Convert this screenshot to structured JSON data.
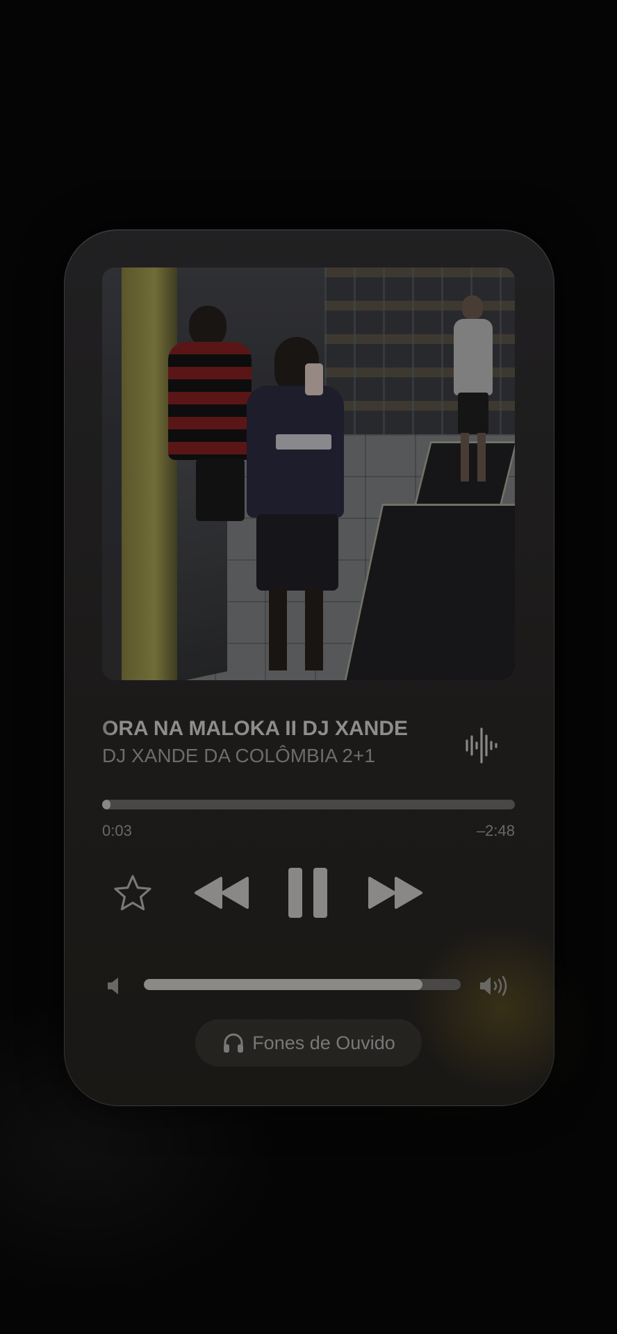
{
  "now_playing": {
    "title": "ORA NA MALOKA II DJ XANDE",
    "artist": "DJ XANDE DA COLÔMBIA 2+1",
    "artwork_icon": "album-artwork-photo",
    "audio_quality_icon": "waveform-icon"
  },
  "progress": {
    "elapsed": "0:03",
    "remaining": "–2:48",
    "fraction": 0.02
  },
  "controls": {
    "favorite_icon": "star-icon",
    "previous_icon": "backward-icon",
    "play_pause_icon": "pause-icon",
    "next_icon": "forward-icon"
  },
  "volume": {
    "level": 0.88,
    "low_icon": "speaker-low-icon",
    "high_icon": "speaker-high-icon"
  },
  "output": {
    "label": "Fones de Ouvido",
    "icon": "headphones-icon"
  },
  "colors": {
    "card_bg": "#222123",
    "text_primary": "#8e8d8b",
    "text_secondary": "#6e6c69",
    "bar_fill": "#8a8886",
    "bar_track": "#4a4846"
  }
}
